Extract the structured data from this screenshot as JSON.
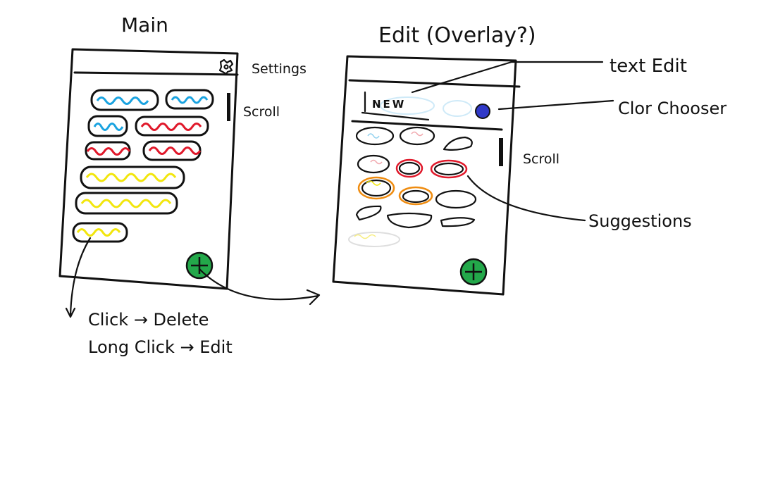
{
  "titles": {
    "main": "Main",
    "edit": "Edit (Overlay?)"
  },
  "annotations": {
    "settings": "Settings",
    "scroll_main": "Scroll",
    "scroll_edit": "Scroll",
    "text_edit": "text Edit",
    "color_chooser": "Clor Chooser",
    "suggestions": "Suggestions",
    "click_action": "Click → Delete",
    "long_click_action": "Long Click → Edit"
  },
  "edit_screen": {
    "text_field_value": "NEW"
  },
  "colors": {
    "blue": "#1aa3e0",
    "red": "#e0182a",
    "yellow": "#f2e60c",
    "orange": "#ef8c10",
    "green": "#23a84a",
    "chooser_blue": "#3039c8",
    "ink": "#111111"
  },
  "icons": {
    "settings": "gear-icon",
    "add": "plus-fab-icon",
    "color": "color-dot-icon"
  }
}
